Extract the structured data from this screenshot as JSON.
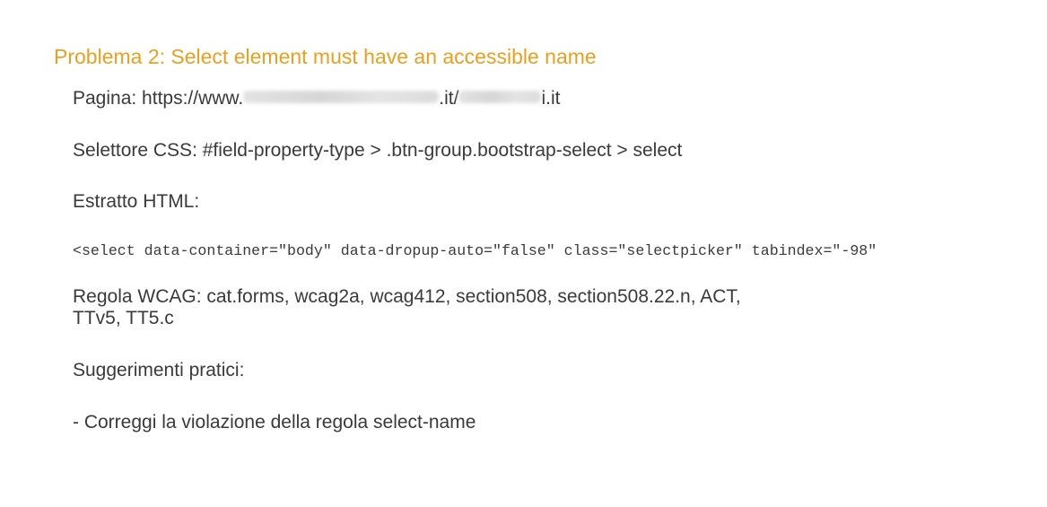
{
  "issue": {
    "title": "Problema 2: Select element must have an accessible name",
    "page": {
      "prefix": "Pagina: https://www.",
      "mid": ".it/",
      "suffix": "i.it"
    },
    "selector": "Selettore CSS: #field-property-type > .btn-group.bootstrap-select > select",
    "html_label": "Estratto HTML:",
    "html_snippet": "<select data-container=\"body\" data-dropup-auto=\"false\" class=\"selectpicker\" tabindex=\"-98\"",
    "wcag_line1": "Regola WCAG: cat.forms, wcag2a, wcag412, section508, section508.22.n, ACT,",
    "wcag_line2": "TTv5, TT5.c",
    "tips_label": "Suggerimenti pratici:",
    "tip": "- Correggi la violazione della regola select-name"
  }
}
